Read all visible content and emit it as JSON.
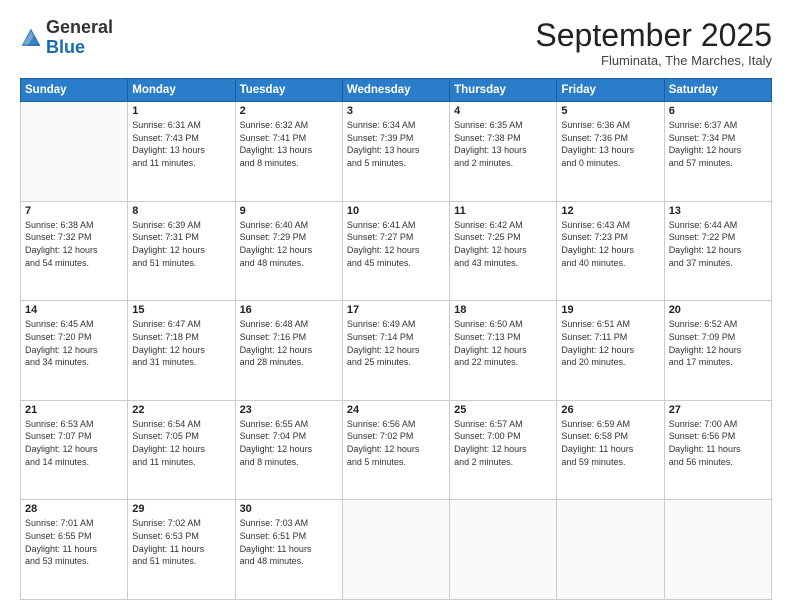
{
  "header": {
    "logo_general": "General",
    "logo_blue": "Blue",
    "month_title": "September 2025",
    "location": "Fluminata, The Marches, Italy"
  },
  "weekdays": [
    "Sunday",
    "Monday",
    "Tuesday",
    "Wednesday",
    "Thursday",
    "Friday",
    "Saturday"
  ],
  "weeks": [
    [
      {
        "day": "",
        "info": ""
      },
      {
        "day": "1",
        "info": "Sunrise: 6:31 AM\nSunset: 7:43 PM\nDaylight: 13 hours\nand 11 minutes."
      },
      {
        "day": "2",
        "info": "Sunrise: 6:32 AM\nSunset: 7:41 PM\nDaylight: 13 hours\nand 8 minutes."
      },
      {
        "day": "3",
        "info": "Sunrise: 6:34 AM\nSunset: 7:39 PM\nDaylight: 13 hours\nand 5 minutes."
      },
      {
        "day": "4",
        "info": "Sunrise: 6:35 AM\nSunset: 7:38 PM\nDaylight: 13 hours\nand 2 minutes."
      },
      {
        "day": "5",
        "info": "Sunrise: 6:36 AM\nSunset: 7:36 PM\nDaylight: 13 hours\nand 0 minutes."
      },
      {
        "day": "6",
        "info": "Sunrise: 6:37 AM\nSunset: 7:34 PM\nDaylight: 12 hours\nand 57 minutes."
      }
    ],
    [
      {
        "day": "7",
        "info": "Sunrise: 6:38 AM\nSunset: 7:32 PM\nDaylight: 12 hours\nand 54 minutes."
      },
      {
        "day": "8",
        "info": "Sunrise: 6:39 AM\nSunset: 7:31 PM\nDaylight: 12 hours\nand 51 minutes."
      },
      {
        "day": "9",
        "info": "Sunrise: 6:40 AM\nSunset: 7:29 PM\nDaylight: 12 hours\nand 48 minutes."
      },
      {
        "day": "10",
        "info": "Sunrise: 6:41 AM\nSunset: 7:27 PM\nDaylight: 12 hours\nand 45 minutes."
      },
      {
        "day": "11",
        "info": "Sunrise: 6:42 AM\nSunset: 7:25 PM\nDaylight: 12 hours\nand 43 minutes."
      },
      {
        "day": "12",
        "info": "Sunrise: 6:43 AM\nSunset: 7:23 PM\nDaylight: 12 hours\nand 40 minutes."
      },
      {
        "day": "13",
        "info": "Sunrise: 6:44 AM\nSunset: 7:22 PM\nDaylight: 12 hours\nand 37 minutes."
      }
    ],
    [
      {
        "day": "14",
        "info": "Sunrise: 6:45 AM\nSunset: 7:20 PM\nDaylight: 12 hours\nand 34 minutes."
      },
      {
        "day": "15",
        "info": "Sunrise: 6:47 AM\nSunset: 7:18 PM\nDaylight: 12 hours\nand 31 minutes."
      },
      {
        "day": "16",
        "info": "Sunrise: 6:48 AM\nSunset: 7:16 PM\nDaylight: 12 hours\nand 28 minutes."
      },
      {
        "day": "17",
        "info": "Sunrise: 6:49 AM\nSunset: 7:14 PM\nDaylight: 12 hours\nand 25 minutes."
      },
      {
        "day": "18",
        "info": "Sunrise: 6:50 AM\nSunset: 7:13 PM\nDaylight: 12 hours\nand 22 minutes."
      },
      {
        "day": "19",
        "info": "Sunrise: 6:51 AM\nSunset: 7:11 PM\nDaylight: 12 hours\nand 20 minutes."
      },
      {
        "day": "20",
        "info": "Sunrise: 6:52 AM\nSunset: 7:09 PM\nDaylight: 12 hours\nand 17 minutes."
      }
    ],
    [
      {
        "day": "21",
        "info": "Sunrise: 6:53 AM\nSunset: 7:07 PM\nDaylight: 12 hours\nand 14 minutes."
      },
      {
        "day": "22",
        "info": "Sunrise: 6:54 AM\nSunset: 7:05 PM\nDaylight: 12 hours\nand 11 minutes."
      },
      {
        "day": "23",
        "info": "Sunrise: 6:55 AM\nSunset: 7:04 PM\nDaylight: 12 hours\nand 8 minutes."
      },
      {
        "day": "24",
        "info": "Sunrise: 6:56 AM\nSunset: 7:02 PM\nDaylight: 12 hours\nand 5 minutes."
      },
      {
        "day": "25",
        "info": "Sunrise: 6:57 AM\nSunset: 7:00 PM\nDaylight: 12 hours\nand 2 minutes."
      },
      {
        "day": "26",
        "info": "Sunrise: 6:59 AM\nSunset: 6:58 PM\nDaylight: 11 hours\nand 59 minutes."
      },
      {
        "day": "27",
        "info": "Sunrise: 7:00 AM\nSunset: 6:56 PM\nDaylight: 11 hours\nand 56 minutes."
      }
    ],
    [
      {
        "day": "28",
        "info": "Sunrise: 7:01 AM\nSunset: 6:55 PM\nDaylight: 11 hours\nand 53 minutes."
      },
      {
        "day": "29",
        "info": "Sunrise: 7:02 AM\nSunset: 6:53 PM\nDaylight: 11 hours\nand 51 minutes."
      },
      {
        "day": "30",
        "info": "Sunrise: 7:03 AM\nSunset: 6:51 PM\nDaylight: 11 hours\nand 48 minutes."
      },
      {
        "day": "",
        "info": ""
      },
      {
        "day": "",
        "info": ""
      },
      {
        "day": "",
        "info": ""
      },
      {
        "day": "",
        "info": ""
      }
    ]
  ]
}
